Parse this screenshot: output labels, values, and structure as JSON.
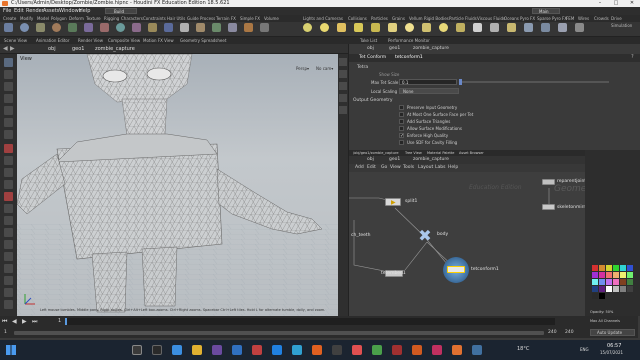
{
  "title_bar": {
    "title": "C:/Users/Admin/Desktop/Zombie/Zombie.hipnc - Houdini FX Education Edition 18.5.621"
  },
  "menu": {
    "items": [
      "File",
      "Edit",
      "Render",
      "Assets",
      "Windows",
      "Help"
    ],
    "build_label": "Build",
    "main_label": "Main"
  },
  "shelf": {
    "tabs": [
      "Create",
      "Modify",
      "Model",
      "Polygon",
      "Deform",
      "Texture",
      "Rigging",
      "Characters",
      "Constraints",
      "Hair Utils",
      "Guide Process",
      "Terrain FX",
      "Simple FX",
      "Volume",
      "Lights and Cameras",
      "Collisions",
      "Particles",
      "Grains",
      "Vellum",
      "Rigid Bodies",
      "Particle Fluids",
      "Viscous Fluids",
      "Oceans",
      "Pyro FX",
      "Sparse Pyro FX",
      "FEM",
      "Wires",
      "Crowds",
      "Drive Simulation"
    ]
  },
  "panel_tabs": {
    "left": [
      "Scene View",
      "Animation Editor",
      "Render View",
      "Composite View",
      "Motion FX View",
      "Geometry Spreadsheet"
    ],
    "right": [
      "Take List",
      "Performance Monitor"
    ]
  },
  "viewport_path": {
    "obj": "obj",
    "geo": "geo1",
    "node": "zombie_capture"
  },
  "viewport": {
    "label": "View",
    "persp": "Persp▾",
    "cam": "No cam▾",
    "status": "Left mouse tumbles. Middle pans. Right dollies. Ctrl+Alt+Left box-zooms. Ctrl+Right zooms. Spacebar Ctrl+Left tiles. Hold L for alternate tumble, dolly, and zoom."
  },
  "params": {
    "path_obj": "obj",
    "path_geo": "geo1",
    "path_node": "zombie_capture",
    "node_type": "Tet Conform",
    "node_name": "tetconform1",
    "section_tetra": "Tetra",
    "show_size": "Show Size",
    "max_tet_scale_label": "Max Tet Scale",
    "max_tet_scale_value": "0.1",
    "local_scaling_label": "Local Scaling",
    "local_scaling_value": "None",
    "section_output": "Output Geometry",
    "checkboxes": [
      {
        "label": "Preserve Input Geometry",
        "checked": false
      },
      {
        "label": "At Most One Surface Face per Tet",
        "checked": false
      },
      {
        "label": "Add Surface Triangles",
        "checked": false
      },
      {
        "label": "Allow Surface Modifications",
        "checked": false
      },
      {
        "label": "Enforce High Quality",
        "checked": true
      },
      {
        "label": "Use SDF for Cavity Filling",
        "checked": false
      }
    ]
  },
  "network": {
    "tabs": [
      "/obj/geo1/zombie_capture",
      "Tree View",
      "Material Palette",
      "Asset Browser"
    ],
    "path_obj": "obj",
    "path_geo": "geo1",
    "path_node": "zombie_capture",
    "menu": [
      "Add",
      "Edit",
      "Go",
      "View",
      "Tools",
      "Layout",
      "Labs",
      "Help"
    ],
    "watermark": "Education Edition",
    "watermark2": "Geometry",
    "nodes": {
      "reparent": "reparentjoints1",
      "skeletonmirror": "skeletonmirror1",
      "split": "split1",
      "teeth": "ch_teeth",
      "body": "body",
      "tetembed": "tetembed1",
      "tetconform": "tetconform1"
    }
  },
  "right_strip": {
    "opacity_label": "Opacity: 50%",
    "max_all": "Max All Channels",
    "auto_update": "Auto Update"
  },
  "timeline": {
    "frame": "1",
    "start": "1",
    "end": "240",
    "end2": "240",
    "ticks": [
      "24",
      "48",
      "72",
      "96",
      "120",
      "144",
      "168",
      "192",
      "216",
      "240"
    ]
  },
  "taskbar": {
    "weather": "18°C",
    "time": "06:57",
    "date": "15/07/2021",
    "lang": "ENG",
    "colors": {
      "start": "#2f6fd8"
    }
  }
}
